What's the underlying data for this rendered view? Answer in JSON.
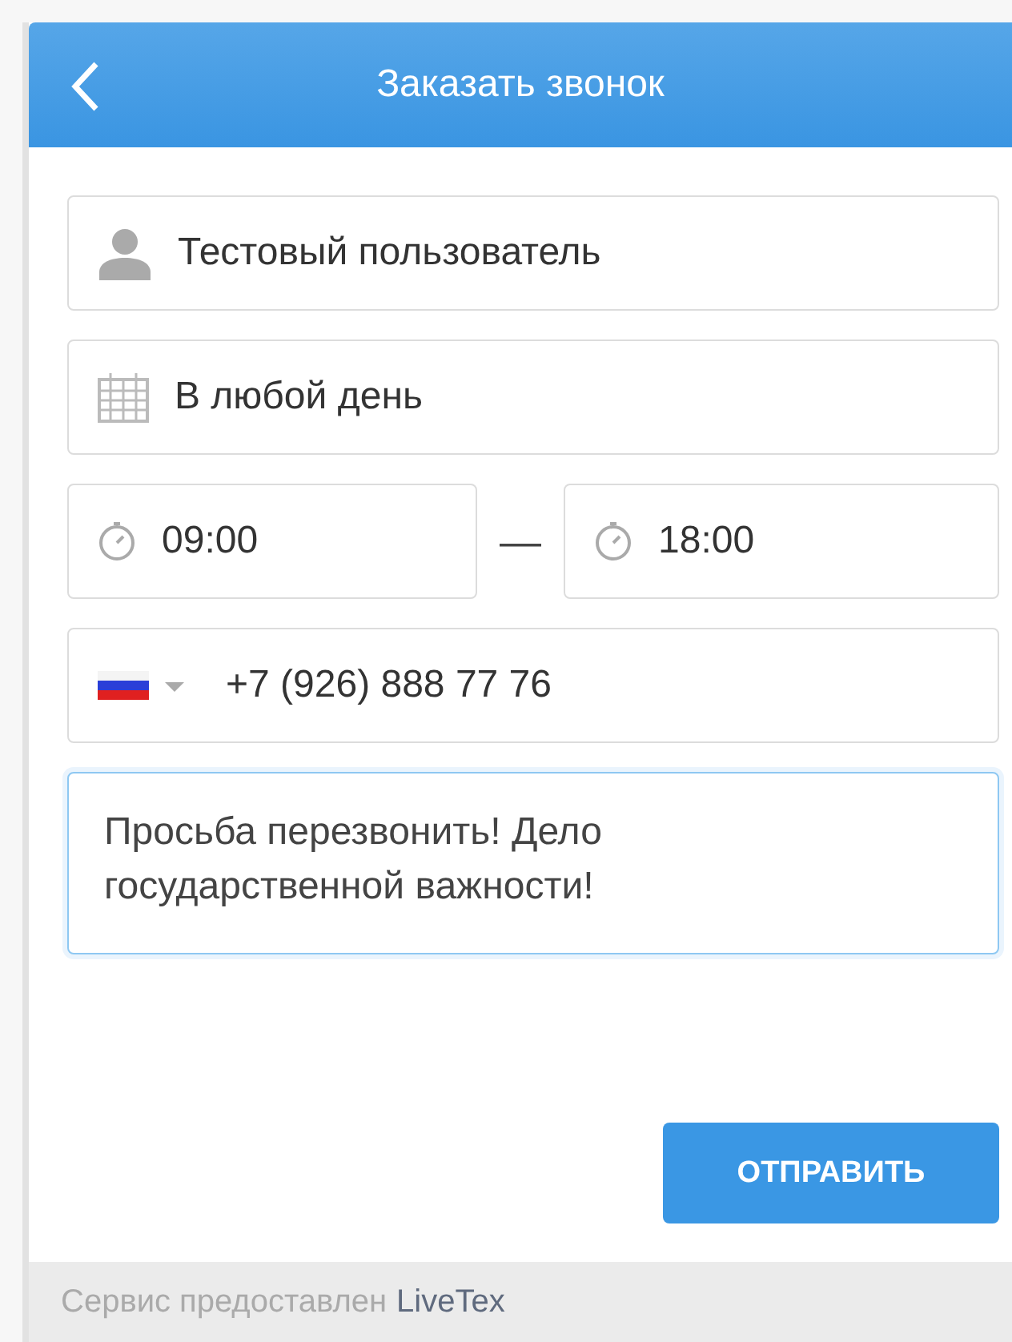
{
  "header": {
    "title": "Заказать звонок"
  },
  "form": {
    "name": {
      "value": "Тестовый пользователь"
    },
    "day": {
      "value": "В любой день"
    },
    "time_from": {
      "value": "09:00"
    },
    "separator": "—",
    "time_to": {
      "value": "18:00"
    },
    "phone": {
      "value": "+7 (926) 888 77 76"
    },
    "message": {
      "value": "Просьба перезвонить! Дело государственной важности!",
      "focused": true
    }
  },
  "submit": "ОТПРАВИТЬ",
  "footer": {
    "text": "Сервис предоставлен",
    "link": "LiveTex"
  }
}
